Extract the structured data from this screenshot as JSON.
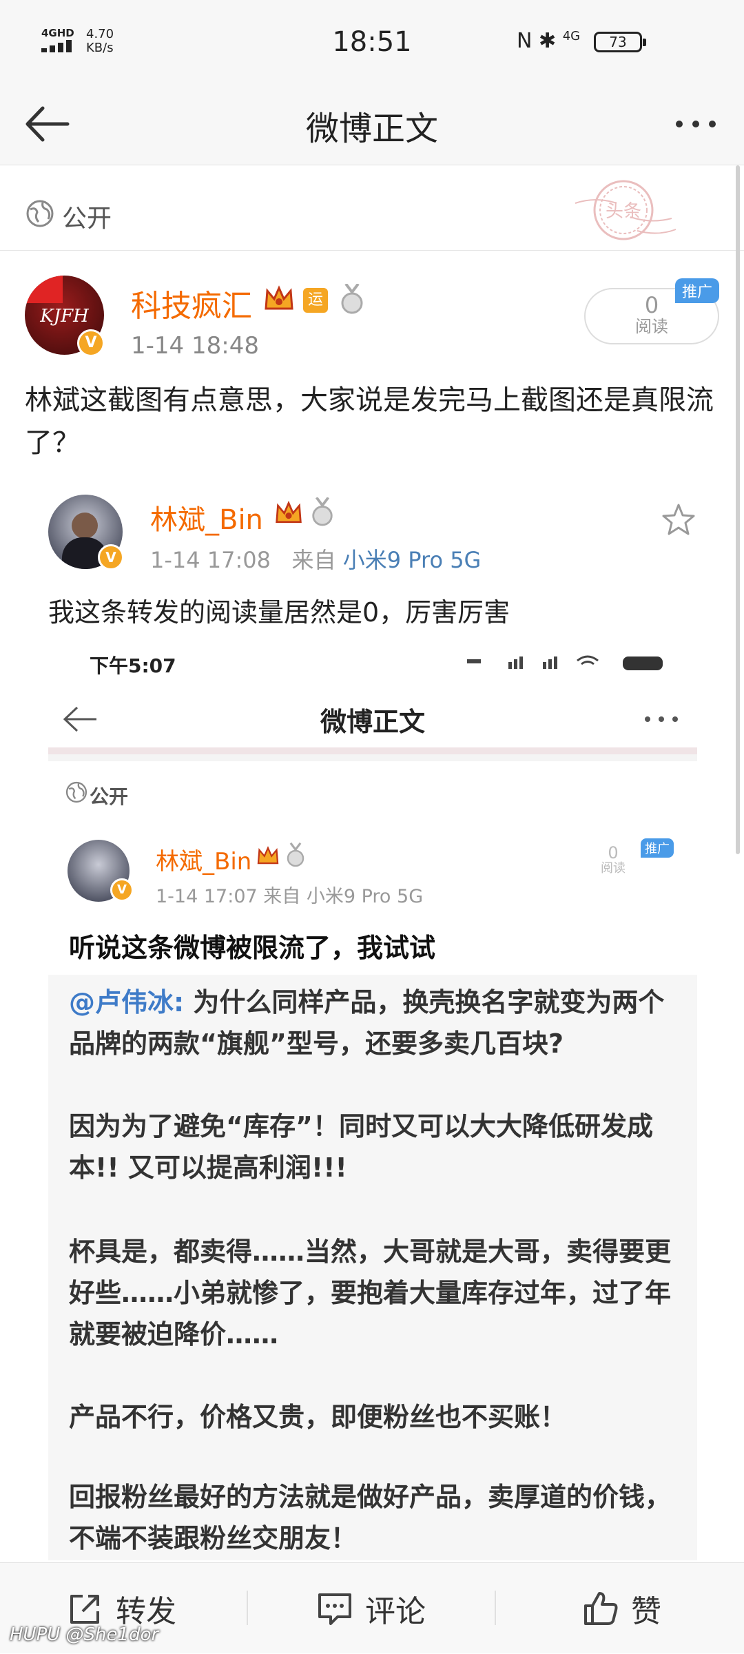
{
  "status_bar": {
    "network": "4GHD",
    "speed_value": "4.70",
    "speed_unit": "KB/s",
    "time": "18:51",
    "network_right": "4G",
    "battery": "73"
  },
  "header": {
    "title": "微博正文"
  },
  "visibility": {
    "label": "公开"
  },
  "stamp_text": "头条",
  "author": {
    "name": "科技疯汇",
    "avatar_text": "KJFH",
    "badge_yun": "运",
    "time": "1-14 18:48"
  },
  "read_count": {
    "value": "0",
    "label": "阅读",
    "promo_tag": "推广"
  },
  "post": {
    "text": "林斌这截图有点意思，大家说是发完马上截图还是真限流了？"
  },
  "repost": {
    "name": "林斌_Bin",
    "time": "1-14 17:08",
    "from_label": "来自",
    "device": "小米9 Pro 5G",
    "text": "我这条转发的阅读量居然是0，厉害厉害"
  },
  "screenshot": {
    "status_time": "下午5:07",
    "title": "微博正文",
    "visibility": "公开",
    "name": "林斌_Bin",
    "meta": "1-14 17:07  来自 小米9 Pro 5G",
    "read_value": "0",
    "read_label": "阅读",
    "promo_tag": "推广",
    "headline": "听说这条微博被限流了，我试试",
    "quote_at": "@卢伟冰:",
    "quote_line1": " 为什么同样产品，换壳换名字就变为两个品牌的两款“旗舰”型号，还要多卖几百块?",
    "quote_p2": "因为为了避免“库存”！同时又可以大大降低研发成本!! 又可以提高利润!!!",
    "quote_p3": "杯具是，都卖得……当然，大哥就是大哥，卖得要更好些……小弟就惨了，要抱着大量库存过年，过了年就要被迫降价……",
    "quote_p4": "产品不行，价格又贵，即便粉丝也不买账！",
    "quote_p5": "回报粉丝最好的方法就是做好产品，卖厚道的价钱，不端不装跟粉丝交朋友！"
  },
  "bottom_bar": {
    "repost": "转发",
    "comment": "评论",
    "like": "赞"
  },
  "watermark": "HUPU @She1dor",
  "colors": {
    "accent_orange": "#f46a00",
    "link_blue": "#4a7fb5",
    "promo_blue": "#4a9be8",
    "verified_gold": "#f5a623"
  }
}
